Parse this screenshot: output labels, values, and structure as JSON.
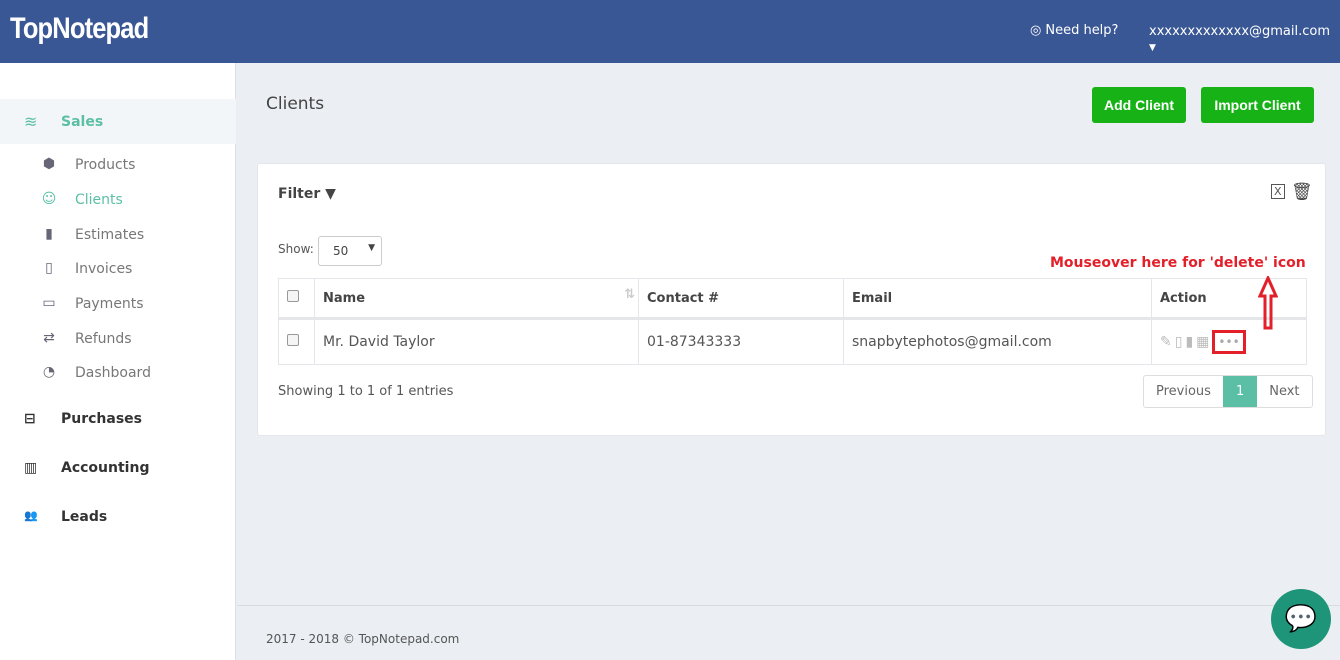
{
  "header": {
    "logo": "TopNotepad",
    "help": "Need help?",
    "user": "xxxxxxxxxxxxx@gmail.com"
  },
  "sidebar": {
    "sales": "Sales",
    "sub": [
      {
        "label": "Products",
        "icon": "cubes-icon"
      },
      {
        "label": "Clients",
        "icon": "user-icon",
        "active": true
      },
      {
        "label": "Estimates",
        "icon": "file-icon"
      },
      {
        "label": "Invoices",
        "icon": "file-outline-icon"
      },
      {
        "label": "Payments",
        "icon": "credit-card-icon"
      },
      {
        "label": "Refunds",
        "icon": "exchange-icon"
      },
      {
        "label": "Dashboard",
        "icon": "dashboard-icon"
      }
    ],
    "main": [
      {
        "label": "Purchases"
      },
      {
        "label": "Accounting"
      },
      {
        "label": "Leads"
      }
    ]
  },
  "page": {
    "title": "Clients",
    "add": "Add Client",
    "import": "Import Client"
  },
  "panel": {
    "filter": "Filter",
    "show": "Show:",
    "show_value": "50",
    "columns": [
      "Name",
      "Contact #",
      "Email",
      "Action"
    ],
    "rows": [
      {
        "name": "Mr. David Taylor",
        "contact": "01-87343333",
        "email": "snapbytephotos@gmail.com"
      }
    ],
    "showing": "Showing 1 to 1 of 1 entries",
    "prev": "Previous",
    "page": "1",
    "next": "Next"
  },
  "annotation": "Mouseover here for 'delete' icon",
  "annotation_color": "#e3202a",
  "accent": "#5bbfa6",
  "footer": "2017 - 2018 © TopNotepad.com"
}
